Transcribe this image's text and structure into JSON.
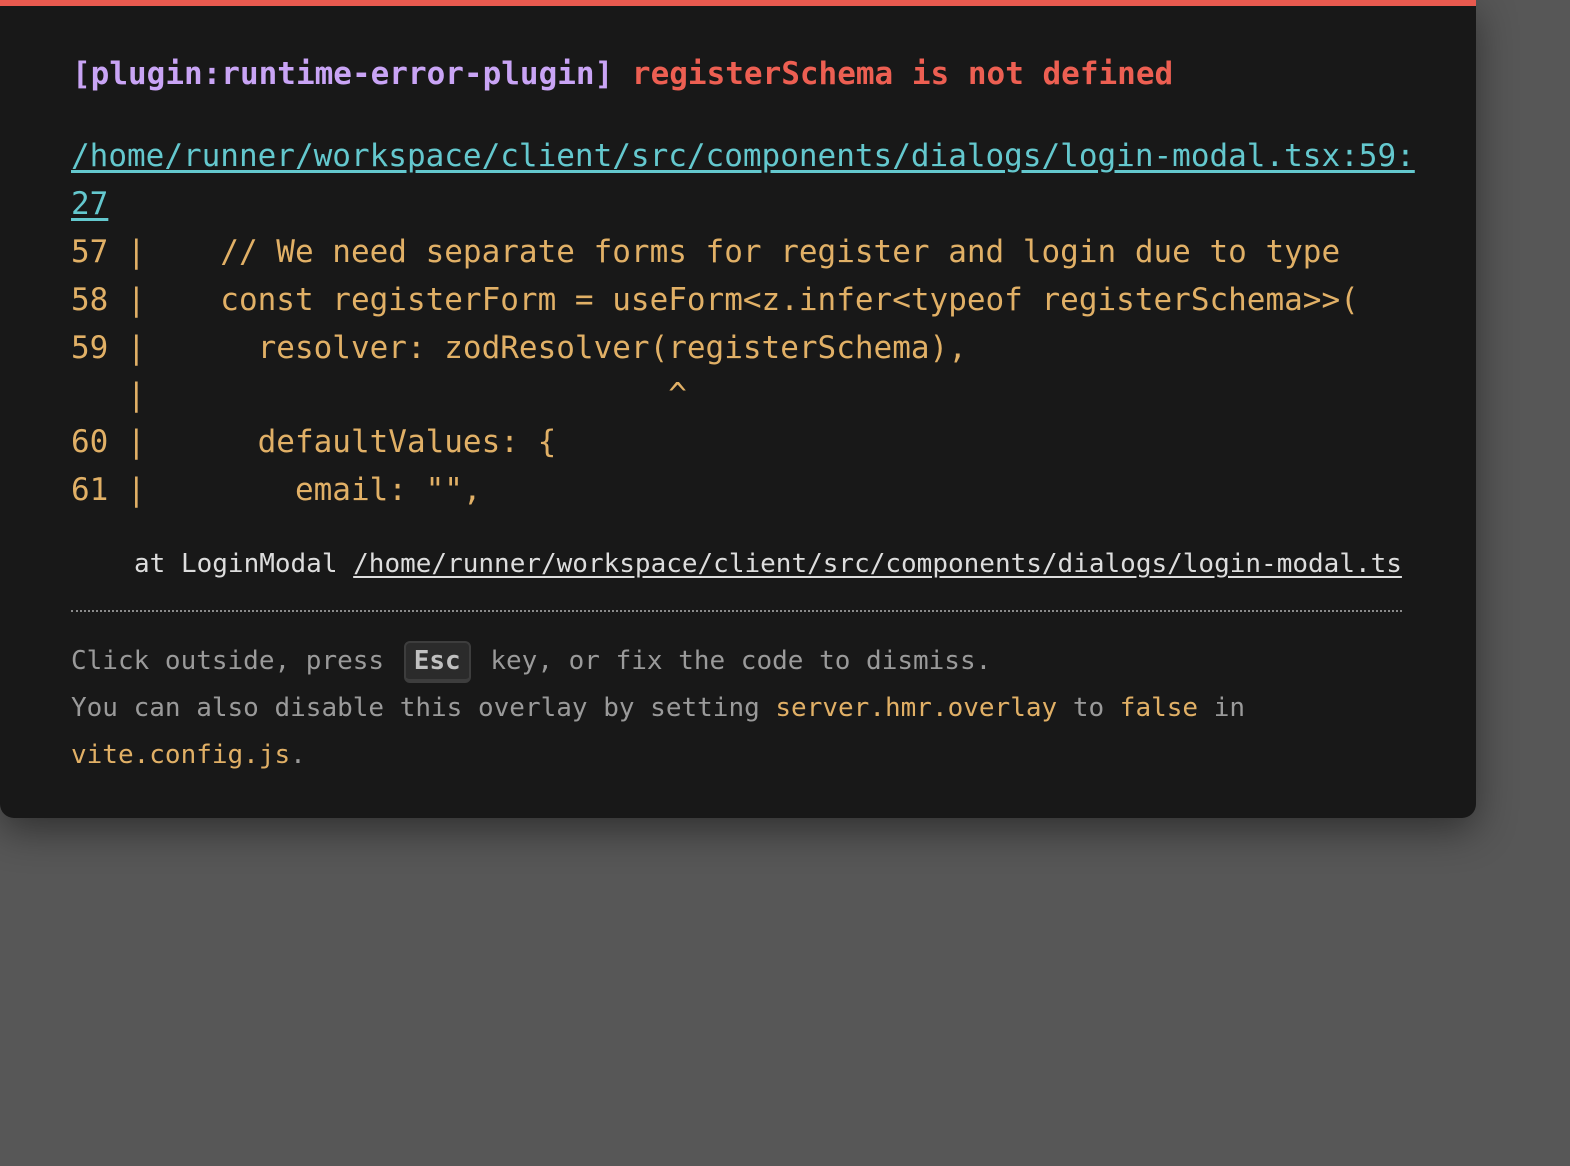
{
  "colors": {
    "accent_bar": "#e85a4f",
    "plugin_tag": "#c9a4f5",
    "error_message": "#ed5f52",
    "file_link": "#64c8ce",
    "code_frame": "#e1b066",
    "tip_text": "#9a9a9a",
    "backdrop": "#575757",
    "panel": "#181818"
  },
  "error": {
    "plugin": "[plugin:runtime-error-plugin]",
    "message": "registerSchema is not defined",
    "file": "/home/runner/workspace/client/src/components/dialogs/login-modal.tsx:59:27",
    "frame": [
      "57 |    // We need separate forms for register and login due to type",
      "58 |    const registerForm = useForm<z.infer<typeof registerSchema>>(",
      "59 |      resolver: zodResolver(registerSchema),",
      "   |                            ^",
      "60 |      defaultValues: {",
      "61 |        email: \"\","
    ],
    "stack_prefix": "at LoginModal ",
    "stack_path": "/home/runner/workspace/client/src/components/dialogs/login-modal.ts"
  },
  "tip": {
    "line1_before": "Click outside, press ",
    "key": "Esc",
    "line1_after": " key, or fix the code to dismiss.",
    "line2_before": "You can also disable this overlay by setting ",
    "config_key": "server.hmr.overlay",
    "to": " to ",
    "value": "false",
    "in": " in",
    "config_file": "vite.config.js",
    "period": "."
  }
}
